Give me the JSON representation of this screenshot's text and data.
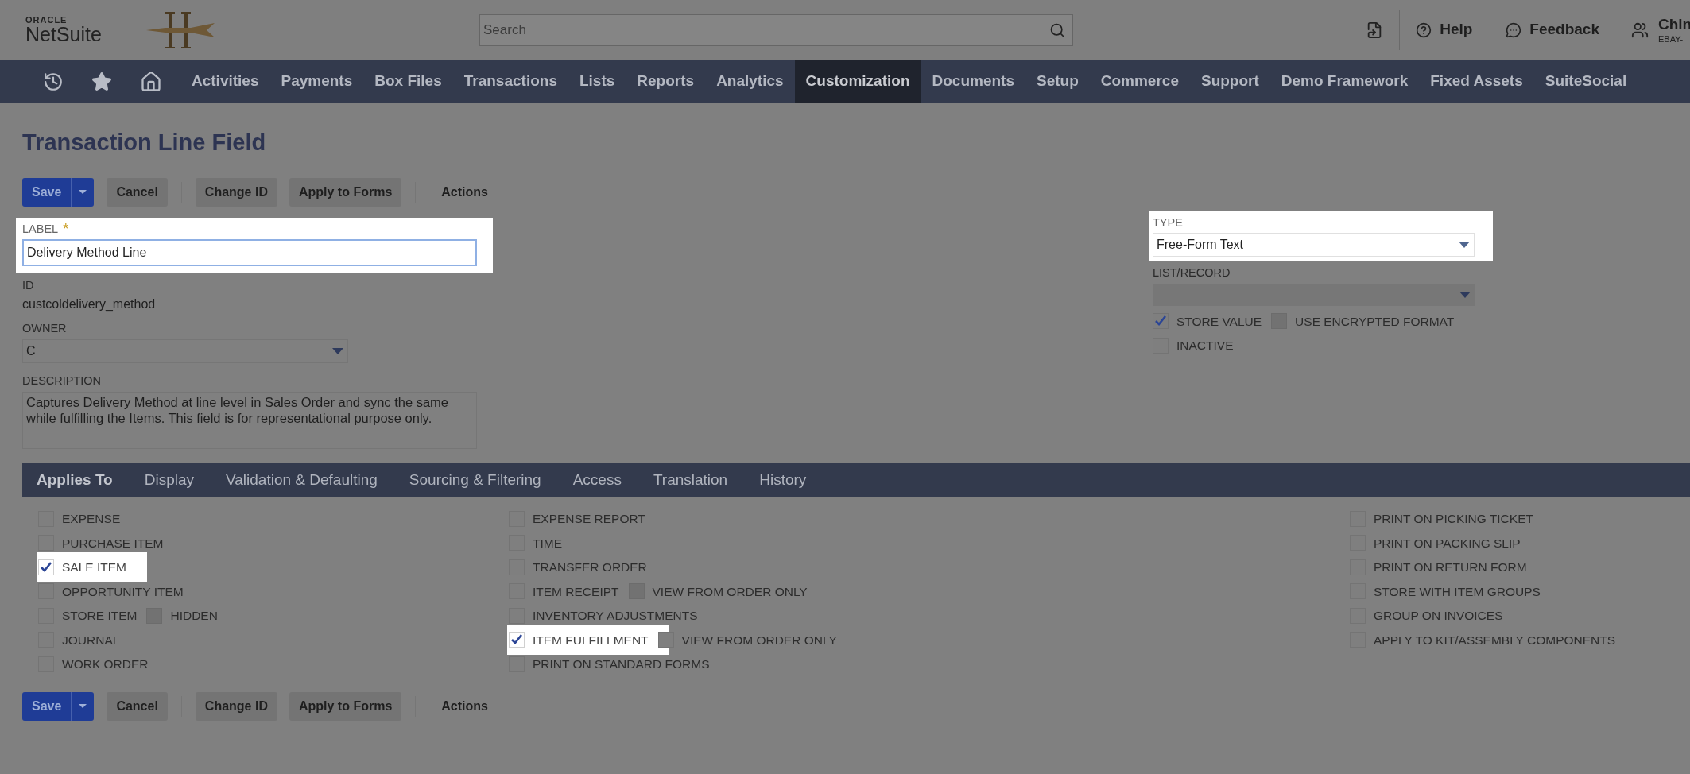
{
  "header": {
    "logo_top": "ORACLE",
    "logo_bottom": "NetSuite",
    "search": {
      "placeholder": "Search"
    },
    "help": "Help",
    "feedback": "Feedback",
    "user_name": "Chin",
    "user_account": "EBAY-"
  },
  "nav": {
    "items": [
      {
        "label": "Activities",
        "selected": false
      },
      {
        "label": "Payments",
        "selected": false
      },
      {
        "label": "Box Files",
        "selected": false
      },
      {
        "label": "Transactions",
        "selected": false
      },
      {
        "label": "Lists",
        "selected": false
      },
      {
        "label": "Reports",
        "selected": false
      },
      {
        "label": "Analytics",
        "selected": false
      },
      {
        "label": "Customization",
        "selected": true
      },
      {
        "label": "Documents",
        "selected": false
      },
      {
        "label": "Setup",
        "selected": false
      },
      {
        "label": "Commerce",
        "selected": false
      },
      {
        "label": "Support",
        "selected": false
      },
      {
        "label": "Demo Framework",
        "selected": false
      },
      {
        "label": "Fixed Assets",
        "selected": false
      },
      {
        "label": "SuiteSocial",
        "selected": false
      }
    ]
  },
  "page_title": "Transaction Line Field",
  "toolbar_top": {
    "save": "Save",
    "buttons": [
      "Cancel",
      "Change ID",
      "Apply to Forms"
    ],
    "actions": "Actions"
  },
  "fields_left": {
    "label": {
      "label": "LABEL",
      "required_mark": "*",
      "value": "Delivery Method Line",
      "highlighted": true
    },
    "id": {
      "label": "ID",
      "value": "custcoldelivery_method"
    },
    "owner": {
      "label": "OWNER",
      "value": "C"
    },
    "description": {
      "label": "DESCRIPTION",
      "value": "Captures Delivery Method at line level in Sales Order and sync the same while fulfilling the Items. This field is for representational purpose only."
    }
  },
  "fields_right": {
    "type": {
      "label": "TYPE",
      "value": "Free-Form Text",
      "highlighted": true
    },
    "list_record": {
      "label": "LIST/RECORD"
    },
    "checkboxes": [
      {
        "label": "STORE VALUE",
        "checked": true,
        "disabled": false,
        "sub": {
          "label": "USE ENCRYPTED FORMAT",
          "checked": false,
          "disabled": true
        }
      },
      {
        "label": "INACTIVE",
        "checked": false,
        "disabled": false
      }
    ]
  },
  "tabs": [
    {
      "label": "Applies To",
      "selected": true
    },
    {
      "label": "Display",
      "selected": false
    },
    {
      "label": "Validation & Defaulting",
      "selected": false
    },
    {
      "label": "Sourcing & Filtering",
      "selected": false
    },
    {
      "label": "Access",
      "selected": false
    },
    {
      "label": "Translation",
      "selected": false
    },
    {
      "label": "History",
      "selected": false
    }
  ],
  "applies_to": [
    [
      {
        "label": "EXPENSE",
        "checked": false,
        "highlighted": false
      },
      {
        "label": "PURCHASE ITEM",
        "checked": false,
        "highlighted": false
      },
      {
        "label": "SALE ITEM",
        "checked": true,
        "highlighted": true
      },
      {
        "label": "OPPORTUNITY ITEM",
        "checked": false,
        "highlighted": false
      },
      {
        "label": "STORE ITEM",
        "checked": false,
        "highlighted": false,
        "sub": {
          "label": "HIDDEN",
          "checked": false,
          "disabled": true
        }
      },
      {
        "label": "JOURNAL",
        "checked": false,
        "highlighted": false
      },
      {
        "label": "WORK ORDER",
        "checked": false,
        "highlighted": false
      }
    ],
    [
      {
        "label": "EXPENSE REPORT",
        "checked": false,
        "highlighted": false
      },
      {
        "label": "TIME",
        "checked": false,
        "highlighted": false
      },
      {
        "label": "TRANSFER ORDER",
        "checked": false,
        "highlighted": false
      },
      {
        "label": "ITEM RECEIPT",
        "checked": false,
        "highlighted": false,
        "sub": {
          "label": "VIEW FROM ORDER ONLY",
          "checked": false,
          "disabled": true
        }
      },
      {
        "label": "INVENTORY ADJUSTMENTS",
        "checked": false,
        "highlighted": false
      },
      {
        "label": "ITEM FULFILLMENT",
        "checked": true,
        "highlighted": true,
        "sub": {
          "label": "VIEW FROM ORDER ONLY",
          "checked": false,
          "disabled": false
        }
      },
      {
        "label": "PRINT ON STANDARD FORMS",
        "checked": false,
        "highlighted": false
      }
    ],
    [
      {
        "label": "PRINT ON PICKING TICKET",
        "checked": false,
        "highlighted": false
      },
      {
        "label": "PRINT ON PACKING SLIP",
        "checked": false,
        "highlighted": false
      },
      {
        "label": "PRINT ON RETURN FORM",
        "checked": false,
        "highlighted": false
      },
      {
        "label": "STORE WITH ITEM GROUPS",
        "checked": false,
        "highlighted": false
      },
      {
        "label": "GROUP ON INVOICES",
        "checked": false,
        "highlighted": false
      },
      {
        "label": "APPLY TO KIT/ASSEMBLY COMPONENTS",
        "checked": false,
        "highlighted": false
      }
    ]
  ],
  "toolbar_bottom": {
    "save": "Save",
    "buttons": [
      "Cancel",
      "Change ID",
      "Apply to Forms"
    ],
    "actions": "Actions"
  }
}
